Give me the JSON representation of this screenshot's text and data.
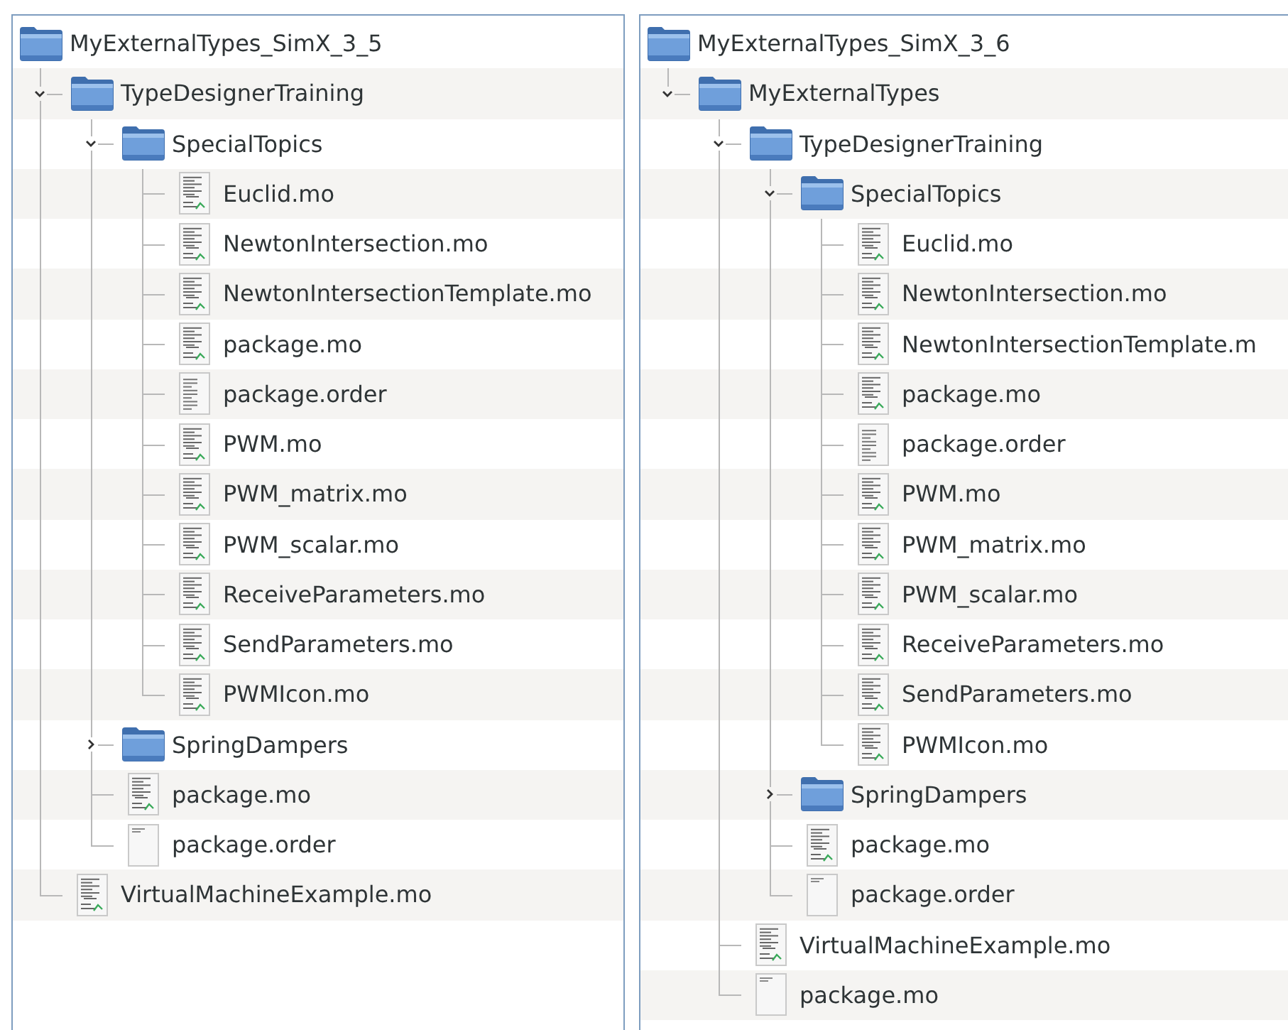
{
  "panels": [
    {
      "tree": [
        {
          "name": "MyExternalTypes_SimX_3_5",
          "kind": "folder",
          "children": [
            {
              "name": "TypeDesignerTraining",
              "kind": "folder",
              "expanded": true,
              "children": [
                {
                  "name": "SpecialTopics",
                  "kind": "folder",
                  "expanded": true,
                  "children": [
                    {
                      "name": "Euclid.mo",
                      "kind": "model"
                    },
                    {
                      "name": "NewtonIntersection.mo",
                      "kind": "model"
                    },
                    {
                      "name": "NewtonIntersectionTemplate.mo",
                      "kind": "model"
                    },
                    {
                      "name": "package.mo",
                      "kind": "model"
                    },
                    {
                      "name": "package.order",
                      "kind": "listing"
                    },
                    {
                      "name": "PWM.mo",
                      "kind": "model"
                    },
                    {
                      "name": "PWM_matrix.mo",
                      "kind": "model"
                    },
                    {
                      "name": "PWM_scalar.mo",
                      "kind": "model"
                    },
                    {
                      "name": "ReceiveParameters.mo",
                      "kind": "model"
                    },
                    {
                      "name": "SendParameters.mo",
                      "kind": "model"
                    },
                    {
                      "name": "PWMIcon.mo",
                      "kind": "model"
                    }
                  ]
                },
                {
                  "name": "SpringDampers",
                  "kind": "folder",
                  "expanded": false
                },
                {
                  "name": "package.mo",
                  "kind": "model"
                },
                {
                  "name": "package.order",
                  "kind": "blank"
                }
              ]
            },
            {
              "name": "VirtualMachineExample.mo",
              "kind": "model"
            }
          ]
        }
      ]
    },
    {
      "tree": [
        {
          "name": "MyExternalTypes_SimX_3_6",
          "kind": "folder",
          "children": [
            {
              "name": "MyExternalTypes",
              "kind": "folder",
              "expanded": true,
              "children": [
                {
                  "name": "TypeDesignerTraining",
                  "kind": "folder",
                  "expanded": true,
                  "children": [
                    {
                      "name": "SpecialTopics",
                      "kind": "folder",
                      "expanded": true,
                      "children": [
                        {
                          "name": "Euclid.mo",
                          "kind": "model"
                        },
                        {
                          "name": "NewtonIntersection.mo",
                          "kind": "model"
                        },
                        {
                          "name": "NewtonIntersectionTemplate.m",
                          "kind": "model"
                        },
                        {
                          "name": "package.mo",
                          "kind": "model"
                        },
                        {
                          "name": "package.order",
                          "kind": "listing"
                        },
                        {
                          "name": "PWM.mo",
                          "kind": "model"
                        },
                        {
                          "name": "PWM_matrix.mo",
                          "kind": "model"
                        },
                        {
                          "name": "PWM_scalar.mo",
                          "kind": "model"
                        },
                        {
                          "name": "ReceiveParameters.mo",
                          "kind": "model"
                        },
                        {
                          "name": "SendParameters.mo",
                          "kind": "model"
                        },
                        {
                          "name": "PWMIcon.mo",
                          "kind": "model"
                        }
                      ]
                    },
                    {
                      "name": "SpringDampers",
                      "kind": "folder",
                      "expanded": false
                    },
                    {
                      "name": "package.mo",
                      "kind": "model"
                    },
                    {
                      "name": "package.order",
                      "kind": "blank"
                    }
                  ]
                },
                {
                  "name": "VirtualMachineExample.mo",
                  "kind": "model"
                },
                {
                  "name": "package.mo",
                  "kind": "blank"
                }
              ]
            }
          ]
        }
      ]
    }
  ]
}
